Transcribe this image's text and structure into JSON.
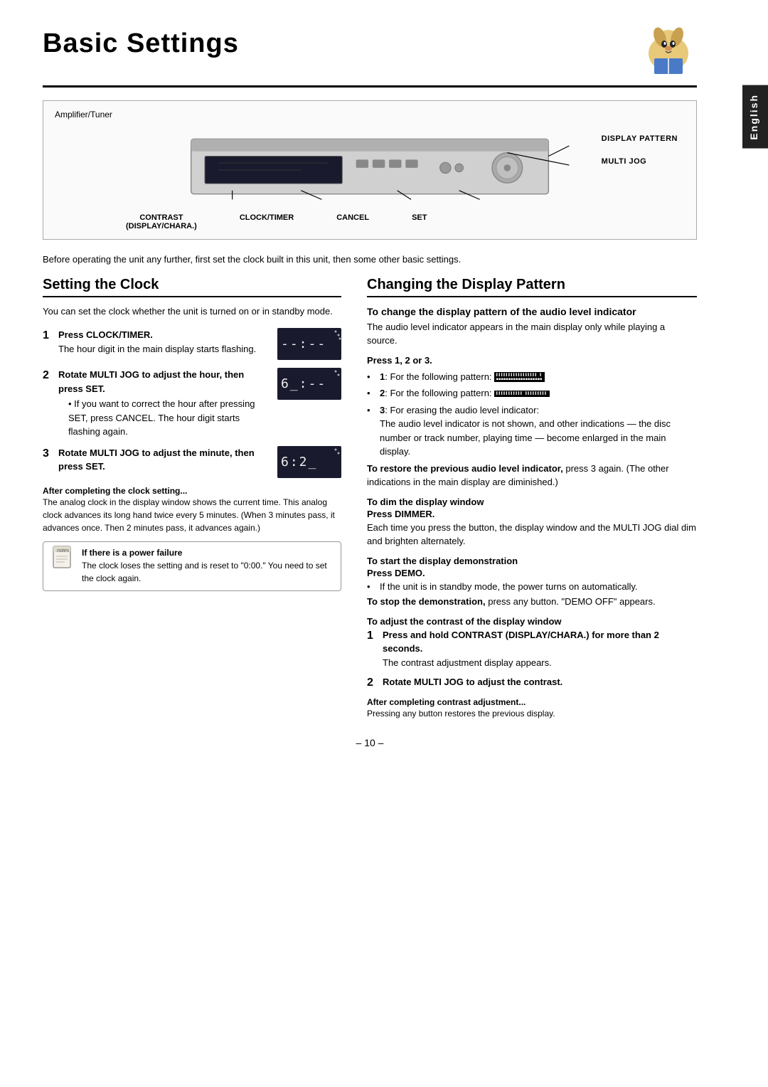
{
  "page": {
    "title": "Basic Settings",
    "page_number": "– 10 –",
    "language_tab": "English"
  },
  "diagram": {
    "label": "Amplifier/Tuner",
    "annotations_right": [
      "DISPLAY PATTERN",
      "MULTI JOG"
    ],
    "bottom_labels": [
      "CONTRAST\n(DISPLAY/CHARA.)",
      "CLOCK/TIMER",
      "CANCEL",
      "SET"
    ]
  },
  "intro": "Before operating the unit any further, first set the clock built in this unit, then some other basic settings.",
  "setting_clock": {
    "heading": "Setting the Clock",
    "intro": "You can set the clock whether the unit is turned on or in standby mode.",
    "steps": [
      {
        "num": "1",
        "bold": "Press CLOCK/TIMER.",
        "text": "The hour digit in the main display starts flashing."
      },
      {
        "num": "2",
        "bold": "Rotate MULTI JOG to adjust the hour, then press SET.",
        "bullet": "If you want to correct the hour after pressing SET, press CANCEL. The hour digit starts flashing again."
      },
      {
        "num": "3",
        "bold": "Rotate MULTI JOG to adjust the minute, then press SET."
      }
    ],
    "after_label": "After completing the clock setting...",
    "after_text": "The analog clock in the display window shows the current time. This analog clock advances its long hand twice every 5 minutes. (When 3 minutes pass, it advances once. Then 2 minutes pass, it advances again.)",
    "notes_heading": "If there is a power failure",
    "notes_text": "The clock loses the setting and is reset to \"0:00.\" You need to set the clock again."
  },
  "changing_display": {
    "heading": "Changing the Display Pattern",
    "audio_level_heading": "To change the display pattern of the audio level indicator",
    "audio_level_intro": "The audio level indicator appears in the main display only while playing a source.",
    "press_label": "Press 1, 2 or 3.",
    "patterns": [
      {
        "number": "1",
        "label": "1",
        "desc": ": For the following pattern:"
      },
      {
        "number": "2",
        "label": "2",
        "desc": ": For the following pattern:"
      },
      {
        "number": "3",
        "label": "3",
        "desc": ": For erasing the audio level indicator:"
      }
    ],
    "pattern3_text": "The audio level indicator is not shown, and other indications — the disc number or track number, playing time — become enlarged in the main display.",
    "restore_text": "To restore the previous audio level indicator, press 3 again. (The other indications in the main display are diminished.)",
    "dim_heading": "To dim the display window",
    "dimmer_label": "Press DIMMER.",
    "dimmer_text": "Each time you press the button, the display window and the MULTI JOG dial dim and brighten alternately.",
    "demo_heading": "To start the display demonstration",
    "demo_label": "Press DEMO.",
    "demo_bullet": "If the unit is in standby mode, the power turns on automatically.",
    "demo_stop": "To stop the demonstration, press any button. \"DEMO OFF\" appears.",
    "contrast_heading": "To adjust the contrast of the display window",
    "contrast_steps": [
      {
        "num": "1",
        "bold": "Press and hold CONTRAST (DISPLAY/CHARA.) for more than 2 seconds.",
        "text": "The contrast adjustment display appears."
      },
      {
        "num": "2",
        "bold": "Rotate MULTI JOG to adjust the contrast."
      }
    ],
    "contrast_after_label": "After completing contrast adjustment...",
    "contrast_after_text": "Pressing any button restores the previous display."
  }
}
